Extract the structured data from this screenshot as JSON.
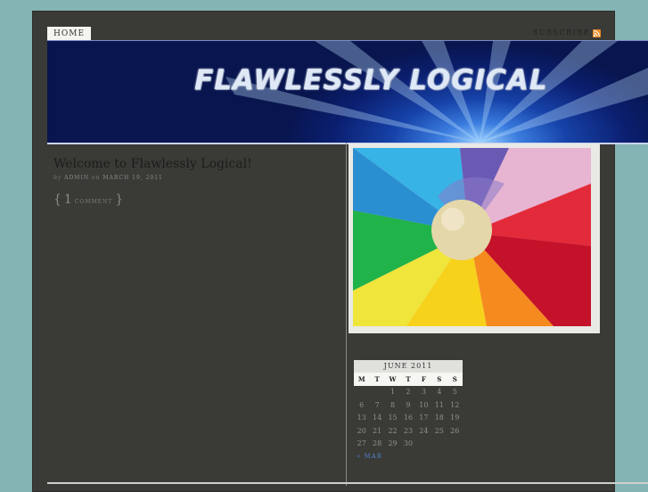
{
  "nav": {
    "home_label": "HOME"
  },
  "subscribe": {
    "label": "SUBSCRIBE",
    "icon": "rss-icon",
    "icon_color": "#f08a24"
  },
  "header": {
    "title": "FLAWLESSLY LOGICAL"
  },
  "post": {
    "title": "Welcome to Flawlessly Logical!",
    "meta_by": "by",
    "author": "ADMIN",
    "meta_on": "on",
    "date": "MARCH 19, 2011",
    "comment_open": "{",
    "comment_count": "1",
    "comment_label": "COMMENT",
    "comment_close": "}"
  },
  "calendar": {
    "caption": "JUNE 2011",
    "days": [
      "M",
      "T",
      "W",
      "T",
      "F",
      "S",
      "S"
    ],
    "weeks": [
      [
        "",
        "",
        "1",
        "2",
        "3",
        "4",
        "5"
      ],
      [
        "6",
        "7",
        "8",
        "9",
        "10",
        "11",
        "12"
      ],
      [
        "13",
        "14",
        "15",
        "16",
        "17",
        "18",
        "19"
      ],
      [
        "20",
        "21",
        "22",
        "23",
        "24",
        "25",
        "26"
      ],
      [
        "27",
        "28",
        "29",
        "30",
        "",
        "",
        ""
      ]
    ],
    "prev_link": "« MAR"
  },
  "colors": {
    "page_bg": "#84b4b3",
    "content_bg": "#3a3a36",
    "link_blue": "#4e7fc7"
  }
}
